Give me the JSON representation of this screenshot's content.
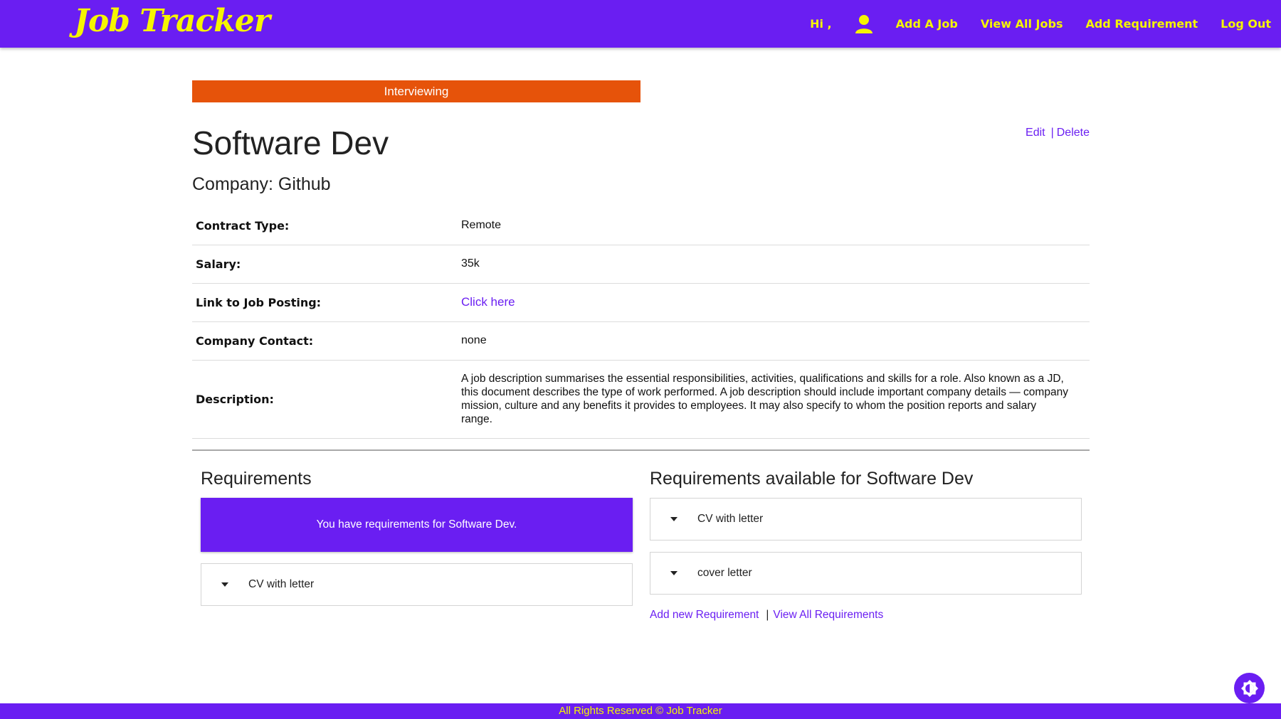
{
  "nav": {
    "logo": "Job Tracker",
    "greeting": "Hi ,",
    "user_icon": "user-icon",
    "items": [
      "Add A Job",
      "View All Jobs",
      "Add Requirement",
      "Log Out"
    ]
  },
  "job": {
    "status": "Interviewing",
    "status_color": "#e6530a",
    "title": "Software Dev",
    "company_line": "Company: Github",
    "edit_label": "Edit",
    "separator": "|",
    "delete_label": "Delete"
  },
  "details": [
    {
      "label": "Contract Type:",
      "value": "Remote"
    },
    {
      "label": "Salary:",
      "value": "35k"
    },
    {
      "label": "Link to Job Posting:",
      "value": "Click here"
    },
    {
      "label": "Company Contact:",
      "value": "none"
    },
    {
      "label": "Description:",
      "value": "A job description summarises the essential responsibilities, activities, qualifications and skills for a role. Also known as a JD, this document describes the type of work performed. A job description should include important company details — company mission, culture and any benefits it provides to employees. It may also specify to whom the position reports and salary range."
    }
  ],
  "requirements": {
    "heading": "Requirements",
    "notice": "You have requirements for Software Dev.",
    "items": [
      "CV with letter"
    ]
  },
  "available": {
    "heading": "Requirements available for Software Dev",
    "items": [
      "CV with letter",
      "cover letter"
    ],
    "add_link": "Add new Requirement",
    "separator": "|",
    "view_link": "View All Requirements"
  },
  "footer": "All Rights Reserved © Job Tracker",
  "colors": {
    "brand": "#6a1ef2",
    "accent": "#f5f500",
    "status": "#e6530a"
  },
  "theme_toggle_icon": "brightness-icon"
}
